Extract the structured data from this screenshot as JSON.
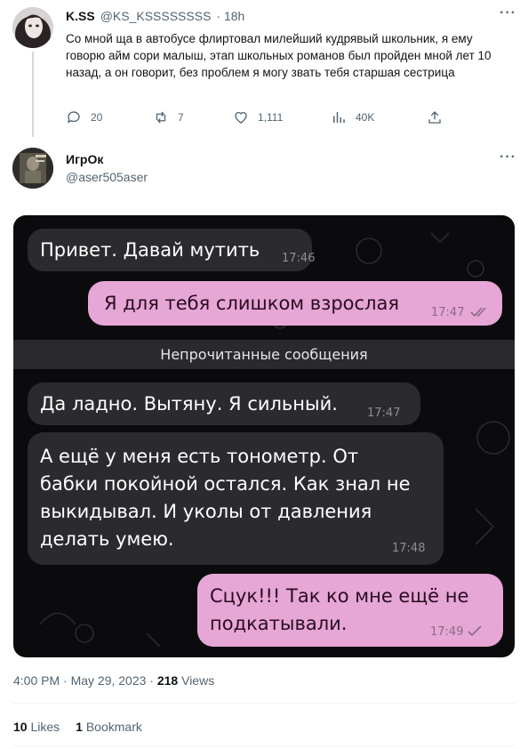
{
  "quoted_tweet": {
    "author_name": "K.SS",
    "author_handle": "@KS_KSSSSSSSS",
    "time": "· 18h",
    "text": "Со мной ща в автобусе флиртовал милейший кудрявый школьник, я ему говорю айм сори малыш, этап школьных романов был пройден мной лет 10 назад, а он говорит, без проблем я могу звать тебя старшая сестрица",
    "replies": "20",
    "retweets": "7",
    "likes": "1,111",
    "views": "40K"
  },
  "main_tweet": {
    "author_name": "ИгрОк",
    "author_handle": "@aser505aser",
    "timestamp": "4:00 PM · May 29, 2023 ·",
    "views_count": "218",
    "views_label": "Views",
    "likes_count": "10",
    "likes_label": "Likes",
    "bookmarks_count": "1",
    "bookmarks_label": "Bookmark"
  },
  "chat": {
    "unread_divider": "Непрочитанные сообщения",
    "messages": [
      {
        "side": "in",
        "text": "Привет. Давай мутить",
        "time": "17:46"
      },
      {
        "side": "out",
        "text": "Я для тебя слишком взрослая",
        "time": "17:47"
      },
      {
        "side": "in",
        "text": "Да ладно. Вытяну. Я сильный.",
        "time": "17:47"
      },
      {
        "side": "in",
        "text": "А ещё у меня есть тонометр. От бабки покойной остался. Как знал не выкидывал. И уколы от давления делать умею.",
        "time": "17:48"
      },
      {
        "side": "out",
        "text": "Сцук!!! Так ко мне ещё не подкатывали.",
        "time": "17:49"
      }
    ]
  },
  "colors": {
    "accent_pink": "#e6a6d6",
    "incoming_bubble": "#2b2b2f",
    "chat_background": "#0b0b0d",
    "muted_text": "#536471"
  }
}
